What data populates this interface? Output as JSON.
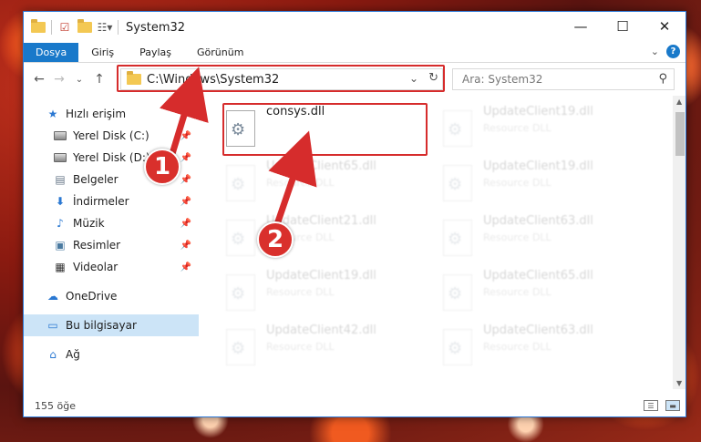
{
  "window": {
    "title": "System32",
    "controls": {
      "minimize": "—",
      "maximize": "☐",
      "close": "✕"
    }
  },
  "ribbon": {
    "tabs": [
      {
        "label": "Dosya",
        "active": true
      },
      {
        "label": "Giriş"
      },
      {
        "label": "Paylaş"
      },
      {
        "label": "Görünüm"
      }
    ]
  },
  "navbar": {
    "address": "C:\\Windows\\System32",
    "search_placeholder": "Ara: System32"
  },
  "sidebar": {
    "quick_access": "Hızlı erişim",
    "items": [
      {
        "label": "Yerel Disk (C:)",
        "icon": "drive-icon"
      },
      {
        "label": "Yerel Disk (D:)",
        "icon": "drive-icon"
      },
      {
        "label": "Belgeler",
        "icon": "documents-icon"
      },
      {
        "label": "İndirmeler",
        "icon": "download-icon"
      },
      {
        "label": "Müzik",
        "icon": "music-icon"
      },
      {
        "label": "Resimler",
        "icon": "pictures-icon"
      },
      {
        "label": "Videolar",
        "icon": "video-icon"
      }
    ],
    "onedrive": "OneDrive",
    "this_pc": "Bu bilgisayar",
    "network": "Ağ"
  },
  "files": [
    {
      "name": "consys.dll",
      "type": "",
      "selected": true
    },
    {
      "name": "UpdateClient19.dll",
      "type": "Resource DLL"
    },
    {
      "name": "UpdateClient65.dll",
      "type": "Resource DLL"
    },
    {
      "name": "UpdateClient19.dll",
      "type": "Resource DLL"
    },
    {
      "name": "UpdateClient21.dll",
      "type": "Resource DLL"
    },
    {
      "name": "UpdateClient63.dll",
      "type": "Resource DLL"
    },
    {
      "name": "UpdateClient19.dll",
      "type": "Resource DLL"
    },
    {
      "name": "UpdateClient65.dll",
      "type": "Resource DLL"
    },
    {
      "name": "UpdateClient42.dll",
      "type": "Resource DLL"
    },
    {
      "name": "UpdateClient63.dll",
      "type": "Resource DLL"
    }
  ],
  "status": {
    "count": "155 öğe"
  },
  "annotations": {
    "step1": "1",
    "step2": "2",
    "color": "#d62c2c"
  }
}
